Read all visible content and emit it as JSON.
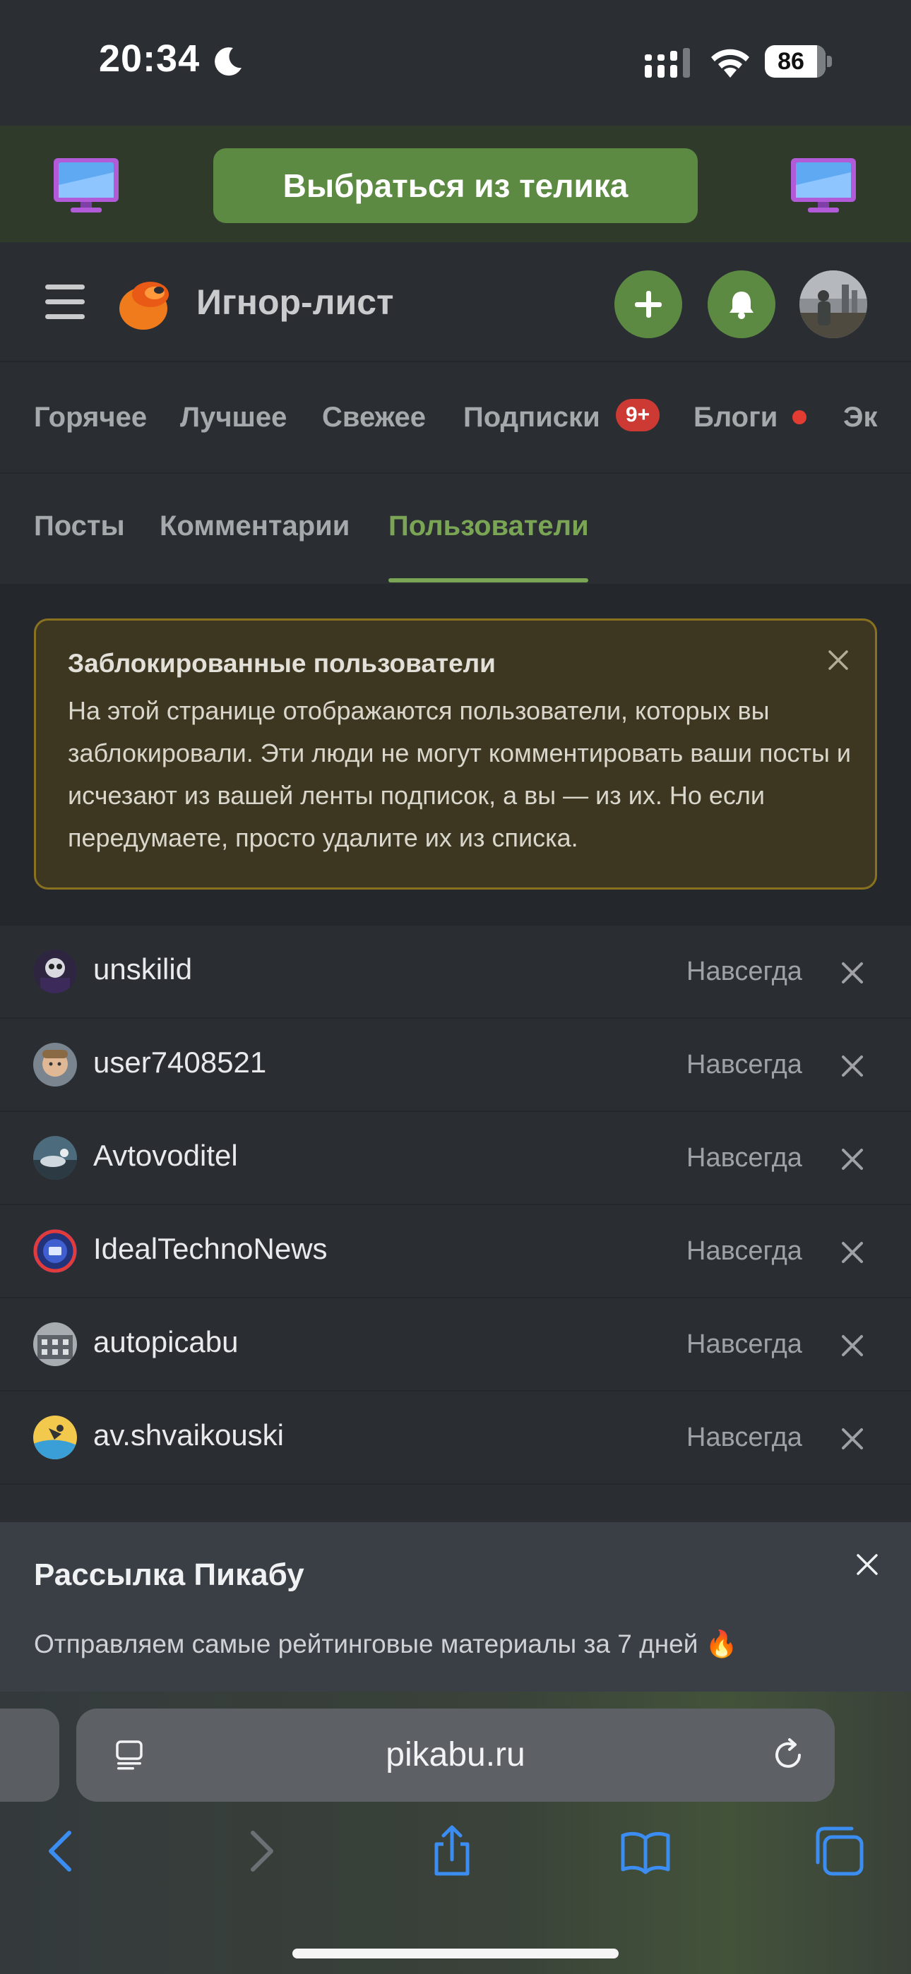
{
  "status_bar": {
    "time": "20:34",
    "battery": "86"
  },
  "promo": {
    "button_label": "Выбраться из телика"
  },
  "header": {
    "title": "Игнор-лист"
  },
  "nav": {
    "items": [
      "Горячее",
      "Лучшее",
      "Свежее",
      "Подписки",
      "Блоги",
      "Эк"
    ],
    "subscriptions_badge": "9+"
  },
  "tabs": {
    "items": [
      "Посты",
      "Комментарии",
      "Пользователи"
    ],
    "active": "Пользователи"
  },
  "info": {
    "title": "Заблокированные пользователи",
    "text": "На этой странице отображаются пользователи, которых вы заблокировали. Эти люди не могут комментировать ваши посты и исчезают из вашей ленты подписок, а вы — из их. Но если передумаете, просто удалите их из списка."
  },
  "blocked_users": [
    {
      "name": "unskilid",
      "duration": "Навсегда"
    },
    {
      "name": "user7408521",
      "duration": "Навсегда"
    },
    {
      "name": "Avtovoditel",
      "duration": "Навсегда"
    },
    {
      "name": "IdealTechnoNews",
      "duration": "Навсегда"
    },
    {
      "name": "autopicabu",
      "duration": "Навсегда"
    },
    {
      "name": "av.shvaikouski",
      "duration": "Навсегда"
    }
  ],
  "newsletter": {
    "title": "Рассылка Пикабу",
    "text": "Отправляем самые рейтинговые материалы за 7 дней 🔥"
  },
  "browser": {
    "url": "pikabu.ru"
  },
  "colors": {
    "accent_green": "#5c8a42",
    "active_tab": "#7aa554",
    "notice_border": "#8a7120",
    "badge_red": "#cc3a33",
    "ios_blue": "#3b8df2"
  }
}
